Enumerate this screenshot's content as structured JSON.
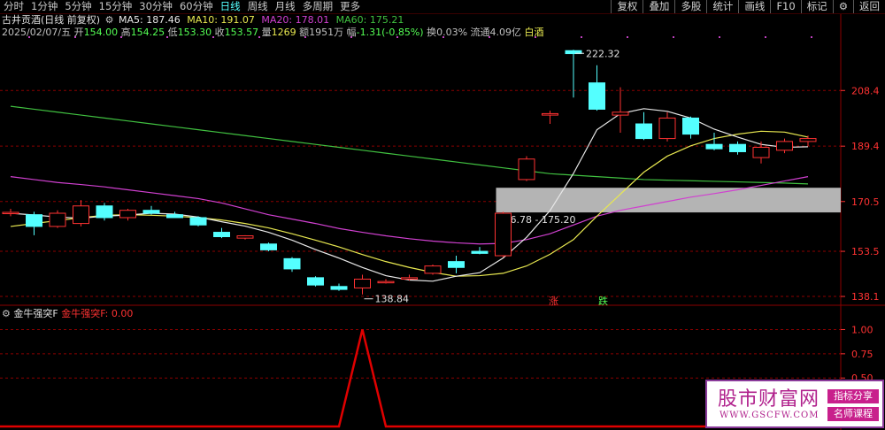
{
  "toolbar": {
    "timeframes": [
      "分时",
      "1分钟",
      "5分钟",
      "15分钟",
      "30分钟",
      "60分钟",
      "日线",
      "周线",
      "月线",
      "多周期",
      "更多"
    ],
    "right_buttons": [
      "复权",
      "叠加",
      "多股",
      "统计",
      "画线",
      "F10",
      "标记",
      "⚙",
      "返回"
    ]
  },
  "legend": {
    "title": "古井贡酒(日线 前复权)",
    "ma5_label": "MA5:",
    "ma5_value": "187.46",
    "ma10_label": "MA10:",
    "ma10_value": "191.07",
    "ma20_label": "MA20:",
    "ma20_value": "178.01",
    "ma60_label": "MA60:",
    "ma60_value": "175.21",
    "date": "2025/02/07/五",
    "open_label": "开",
    "open": "154.00",
    "high_label": "高",
    "high": "154.25",
    "low_label": "低",
    "low": "153.30",
    "close_label": "收",
    "close": "153.57",
    "volume_label": "量",
    "volume": "1269",
    "amount_label": "额",
    "amount": "1951万",
    "change_label": "幅",
    "change": "-1.31(-0.85%)",
    "turnover_label": "换",
    "turnover": "0.03%",
    "float_label": "流通",
    "float": "4.09亿",
    "sector": "白酒"
  },
  "indicator": {
    "name": "金牛强突F",
    "series_label": "金牛强突F:",
    "series_value": "0.00"
  },
  "colors": {
    "up": "#ff3232",
    "down": "#54ffff",
    "ma5": "#e8e8e8",
    "ma10": "#e8e850",
    "ma20": "#d040d0",
    "ma60": "#40c040",
    "axis_text": "#ff3232",
    "grid": "#8b0000",
    "box": "#b4b4b4",
    "signal": "#e00000"
  },
  "chart_data": {
    "type": "candlestick",
    "y_axis": {
      "min": 136,
      "max": 226,
      "ticks": [
        208.4,
        189.4,
        170.5,
        153.5,
        138.1
      ]
    },
    "indicator_axis": {
      "min": 0,
      "max": 1.05,
      "ticks": [
        1.0,
        0.75,
        0.5
      ]
    },
    "candles": [
      {
        "o": 166.5,
        "h": 168.0,
        "l": 165.5,
        "c": 166.8
      },
      {
        "o": 166.0,
        "h": 167.0,
        "l": 159.0,
        "c": 162.0
      },
      {
        "o": 162.0,
        "h": 167.5,
        "l": 161.5,
        "c": 166.5
      },
      {
        "o": 163.0,
        "h": 171.0,
        "l": 162.0,
        "c": 169.0
      },
      {
        "o": 169.0,
        "h": 170.0,
        "l": 164.0,
        "c": 165.0
      },
      {
        "o": 165.0,
        "h": 168.0,
        "l": 164.0,
        "c": 167.5
      },
      {
        "o": 167.5,
        "h": 169.0,
        "l": 166.0,
        "c": 166.5
      },
      {
        "o": 166.0,
        "h": 167.0,
        "l": 165.0,
        "c": 165.0
      },
      {
        "o": 165.0,
        "h": 165.5,
        "l": 162.0,
        "c": 162.5
      },
      {
        "o": 160.0,
        "h": 161.5,
        "l": 158.0,
        "c": 158.5
      },
      {
        "o": 158.0,
        "h": 159.0,
        "l": 157.5,
        "c": 158.8
      },
      {
        "o": 156.0,
        "h": 156.5,
        "l": 153.5,
        "c": 154.0
      },
      {
        "o": 151.0,
        "h": 151.5,
        "l": 146.5,
        "c": 147.5
      },
      {
        "o": 144.5,
        "h": 145.0,
        "l": 141.5,
        "c": 142.0
      },
      {
        "o": 141.5,
        "h": 142.5,
        "l": 140.0,
        "c": 140.5
      },
      {
        "o": 141.0,
        "h": 145.5,
        "l": 138.8,
        "c": 144.0
      },
      {
        "o": 143.0,
        "h": 144.0,
        "l": 142.5,
        "c": 143.2
      },
      {
        "o": 144.0,
        "h": 145.5,
        "l": 143.5,
        "c": 144.5
      },
      {
        "o": 146.0,
        "h": 149.0,
        "l": 145.5,
        "c": 148.5
      },
      {
        "o": 150.0,
        "h": 152.0,
        "l": 146.0,
        "c": 148.0
      },
      {
        "o": 153.5,
        "h": 155.0,
        "l": 152.5,
        "c": 152.8
      },
      {
        "o": 152.0,
        "h": 167.0,
        "l": 151.5,
        "c": 166.5
      },
      {
        "o": 178.0,
        "h": 186.0,
        "l": 177.5,
        "c": 185.0
      },
      {
        "o": 200.0,
        "h": 201.5,
        "l": 197.0,
        "c": 200.5
      },
      {
        "o": 222.0,
        "h": 222.3,
        "l": 206.0,
        "c": 221.0
      },
      {
        "o": 211.0,
        "h": 217.0,
        "l": 201.5,
        "c": 202.0
      },
      {
        "o": 200.0,
        "h": 209.5,
        "l": 194.0,
        "c": 201.0
      },
      {
        "o": 197.0,
        "h": 201.0,
        "l": 191.5,
        "c": 192.0
      },
      {
        "o": 192.0,
        "h": 201.0,
        "l": 191.0,
        "c": 199.0
      },
      {
        "o": 199.0,
        "h": 199.5,
        "l": 192.0,
        "c": 193.5
      },
      {
        "o": 190.0,
        "h": 194.0,
        "l": 188.0,
        "c": 188.5
      },
      {
        "o": 190.0,
        "h": 191.0,
        "l": 186.5,
        "c": 187.5
      },
      {
        "o": 185.5,
        "h": 191.0,
        "l": 183.5,
        "c": 189.0
      },
      {
        "o": 188.0,
        "h": 192.0,
        "l": 187.0,
        "c": 191.0
      },
      {
        "o": 191.0,
        "h": 193.0,
        "l": 189.5,
        "c": 192.0
      }
    ],
    "ma5": [
      166.5,
      165.9,
      165.2,
      164.8,
      165.5,
      165.9,
      166.5,
      166.2,
      165.2,
      163.6,
      162.1,
      160.0,
      157.3,
      154.1,
      151.2,
      148.0,
      145.2,
      143.7,
      143.3,
      145.0,
      146.2,
      151.2,
      158.3,
      167.4,
      180.1,
      195.0,
      200.5,
      202.2,
      201.3,
      199.0,
      195.2,
      192.5,
      190.0,
      189.0,
      189.2
    ],
    "ma10": [
      162.0,
      163.0,
      164.0,
      165.0,
      165.8,
      166.0,
      165.8,
      165.5,
      165.0,
      164.2,
      163.0,
      161.5,
      159.5,
      157.3,
      155.0,
      152.4,
      150.0,
      148.0,
      146.3,
      145.0,
      145.2,
      146.0,
      148.5,
      152.5,
      157.5,
      165.5,
      173.0,
      180.5,
      186.0,
      189.5,
      192.0,
      193.5,
      194.5,
      194.2,
      192.5
    ],
    "ma20": [
      179.0,
      178.0,
      177.0,
      176.3,
      175.5,
      174.5,
      173.5,
      172.5,
      171.5,
      170.0,
      168.0,
      166.0,
      164.5,
      163.0,
      161.3,
      160.0,
      158.8,
      157.8,
      157.0,
      156.4,
      156.0,
      156.2,
      157.5,
      159.5,
      162.5,
      165.5,
      167.5,
      169.0,
      170.5,
      172.0,
      173.2,
      174.5,
      176.0,
      177.5,
      179.0
    ],
    "ma60": [
      203.0,
      202.0,
      201.0,
      200.0,
      199.0,
      198.0,
      197.0,
      196.0,
      195.0,
      194.0,
      193.0,
      192.0,
      191.0,
      190.0,
      189.0,
      188.0,
      187.0,
      186.0,
      185.0,
      184.0,
      183.0,
      182.0,
      181.0,
      180.0,
      179.5,
      179.0,
      178.5,
      178.0,
      177.8,
      177.6,
      177.4,
      177.2,
      177.0,
      176.8,
      176.5
    ],
    "annotations": {
      "high_label": "222.32",
      "low_label": "138.84",
      "box_label": "166.78 - 175.20",
      "box_low": 166.78,
      "box_high": 175.2,
      "marker_up": "涨",
      "marker_down": "跌"
    },
    "indicator": [
      0,
      0,
      0,
      0,
      0,
      0,
      0,
      0,
      0,
      0,
      0,
      0,
      0,
      0,
      0,
      1,
      0,
      0,
      0,
      0,
      0,
      0,
      0,
      0,
      0,
      0,
      0,
      0,
      0,
      0,
      0,
      0,
      0,
      0,
      0
    ]
  },
  "watermark": {
    "title": "股市财富网",
    "url": "WWW.GSCFW.COM",
    "tag1": "指标分享",
    "tag2": "名师课程"
  }
}
